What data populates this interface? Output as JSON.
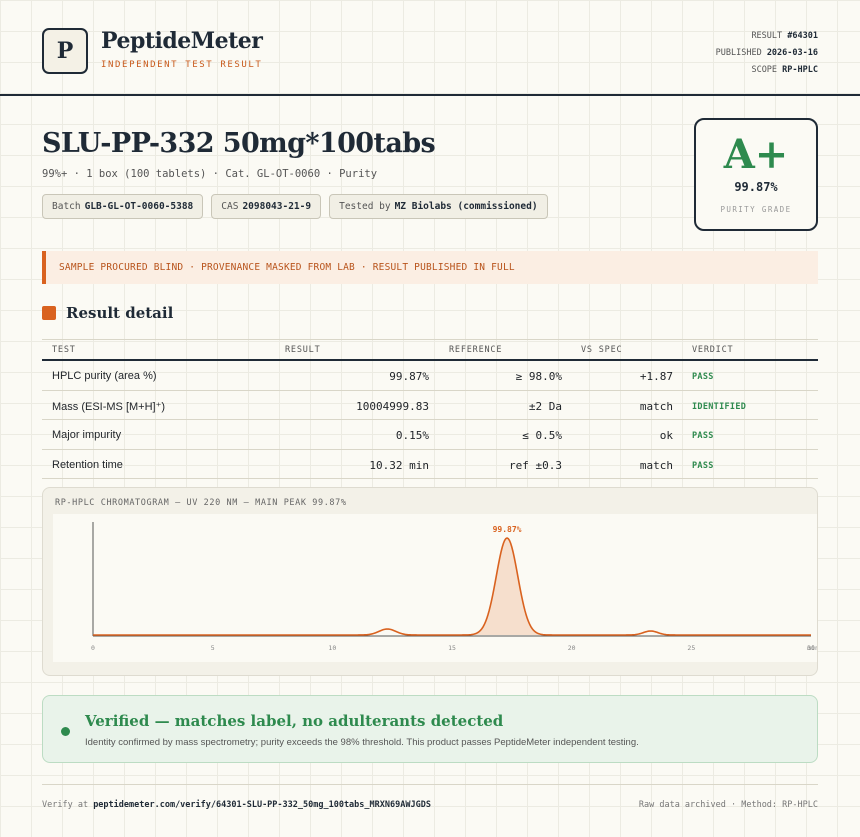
{
  "brand": {
    "logo_letter": "P",
    "name": "PeptideMeter",
    "tagline": "INDEPENDENT TEST RESULT"
  },
  "meta": {
    "result_label": "RESULT",
    "result_value": "#64301",
    "published_label": "PUBLISHED",
    "published_value": "2026-03-16",
    "scope_label": "SCOPE",
    "scope_value": "RP-HPLC"
  },
  "product": {
    "title": "SLU-PP-332 50mg*100tabs",
    "subtitle": "99%+ · 1 box (100 tablets) · Cat. GL-OT-0060 · Purity",
    "chips": [
      {
        "label": "Batch",
        "value": "GLB-GL-OT-0060-5388"
      },
      {
        "label": "CAS",
        "value": "2098043-21-9"
      },
      {
        "label": "Tested by",
        "value": "MZ Biolabs (commissioned)"
      }
    ]
  },
  "grade": {
    "letter": "A+",
    "value": "99.87%",
    "label": "PURITY GRADE"
  },
  "notice": "SAMPLE PROCURED BLIND · PROVENANCE MASKED FROM LAB · RESULT PUBLISHED IN FULL",
  "section_title": "Result detail",
  "table": {
    "headers": {
      "test": "TEST",
      "result": "RESULT",
      "reference": "REFERENCE",
      "vs_spec": "VS SPEC",
      "verdict": "VERDICT"
    },
    "rows": [
      {
        "test": "HPLC purity (area %)",
        "result": "99.87%",
        "reference": "≥ 98.0%",
        "vs_spec": "+1.87",
        "verdict": "PASS"
      },
      {
        "test": "Mass (ESI-MS [M+H]⁺)",
        "result": "10004999.83",
        "reference": "±2 Da",
        "vs_spec": "match",
        "verdict": "IDENTIFIED"
      },
      {
        "test": "Major impurity",
        "result": "0.15%",
        "reference": "≤ 0.5%",
        "vs_spec": "ok",
        "verdict": "PASS"
      },
      {
        "test": "Retention time",
        "result": "10.32 min",
        "reference": "ref ±0.3",
        "vs_spec": "match",
        "verdict": "PASS"
      }
    ]
  },
  "chromatogram_title": "RP-HPLC CHROMATOGRAM — UV 220 NM — MAIN PEAK 99.87%",
  "chart_data": {
    "type": "line",
    "title": "RP-HPLC CHROMATOGRAM — UV 220 NM — MAIN PEAK 99.87%",
    "xlabel": "",
    "ylabel": "",
    "xlim": [
      0,
      30
    ],
    "x_ticks": [
      "0",
      "5",
      "10",
      "15",
      "20",
      "25",
      "30"
    ],
    "x_tick_suffix": "min",
    "baseline": 0.01,
    "peaks": [
      {
        "center": 12.3,
        "height": 0.06,
        "width": 0.35
      },
      {
        "center": 17.3,
        "height": 0.97,
        "width": 0.45,
        "label": "99.87%"
      },
      {
        "center": 23.3,
        "height": 0.04,
        "width": 0.3
      }
    ],
    "ylim": [
      0,
      1.1
    ],
    "line_color": "#d9621f",
    "fill_color": "#f6dfcd",
    "grid": false
  },
  "verified": {
    "title": "Verified — matches label, no adulterants detected",
    "text": "Identity confirmed by mass spectrometry; purity exceeds the 98% threshold. This product passes PeptideMeter independent testing."
  },
  "footer": {
    "verify_label": "Verify at",
    "verify_url": "peptidemeter.com/verify/64301-SLU-PP-332_50mg_100tabs_MRXN69AWJGDS",
    "right": "Raw data archived · Method: RP-HPLC"
  },
  "colors": {
    "accent": "#d9621f",
    "pass": "#2e8a4e",
    "ink": "#1f2a36"
  }
}
